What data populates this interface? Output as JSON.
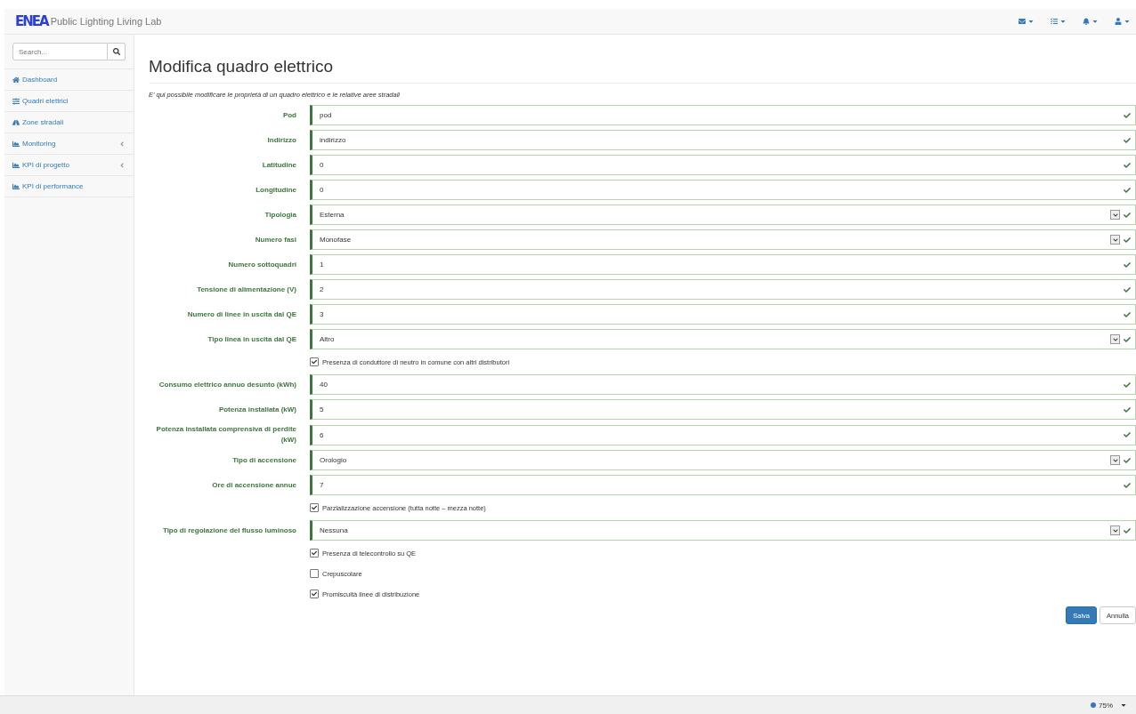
{
  "navbar": {
    "logo": "ENEA",
    "title": "Public Lighting Living Lab",
    "menus": [
      {
        "kind": "envelope"
      },
      {
        "kind": "tasks"
      },
      {
        "kind": "bell"
      },
      {
        "kind": "user"
      }
    ]
  },
  "sidebar": {
    "search": {
      "placeholder": "Search..."
    },
    "items": [
      {
        "label": "Dashboard",
        "submenu": false
      },
      {
        "label": "Quadri elettrici",
        "submenu": false
      },
      {
        "label": "Zone stradali",
        "submenu": false
      },
      {
        "label": "Monitoring",
        "submenu": true
      },
      {
        "label": "KPI di progetto",
        "submenu": true
      },
      {
        "label": "KPI di performance",
        "submenu": false
      }
    ]
  },
  "page": {
    "title": "Modifica quadro elettrico",
    "description": "E' qui possibile modificare le proprietà di un quadro elettrico e le relative aree stradali"
  },
  "form": {
    "fields": [
      {
        "kind": "text",
        "label": "Pod",
        "value": "pod",
        "valid": true
      },
      {
        "kind": "text",
        "label": "Indirizzo",
        "value": "indirizzo",
        "valid": true
      },
      {
        "kind": "text",
        "label": "Latitudine",
        "value": "0",
        "valid": true
      },
      {
        "kind": "text",
        "label": "Longitudine",
        "value": "0",
        "valid": true
      },
      {
        "kind": "select",
        "label": "Tipologia",
        "value": "Esterna",
        "valid": true
      },
      {
        "kind": "select",
        "label": "Numero fasi",
        "value": "Monofase",
        "valid": true
      },
      {
        "kind": "text",
        "label": "Numero sottoquadri",
        "value": "1",
        "valid": true
      },
      {
        "kind": "text",
        "label": "Tensione di alimentazione (V)",
        "value": "2",
        "valid": true
      },
      {
        "kind": "text",
        "label": "Numero di linee in uscita dal QE",
        "value": "3",
        "valid": true
      },
      {
        "kind": "select",
        "label": "Tipo linea in uscita dal QE",
        "value": "Altro",
        "valid": true
      },
      {
        "kind": "checkbox",
        "label": "Presenza di conduttore di neutro in comune con altri distributori",
        "checked": true
      },
      {
        "kind": "text",
        "label": "Consumo elettrico annuo desunto (kWh)",
        "value": "40",
        "valid": true
      },
      {
        "kind": "text",
        "label": "Potenza installata (kW)",
        "value": "5",
        "valid": true
      },
      {
        "kind": "text",
        "label": "Potenza installata comprensiva di perdite (kW)",
        "value": "6",
        "valid": true
      },
      {
        "kind": "select",
        "label": "Tipo di accensione",
        "value": "Orologio",
        "valid": true
      },
      {
        "kind": "text",
        "label": "Ore di accensione annue",
        "value": "7",
        "valid": true
      },
      {
        "kind": "checkbox",
        "label": "Parzializzazione accensione (tutta notte – mezza notte)",
        "checked": true
      },
      {
        "kind": "select",
        "label": "Tipo di regolazione del flusso luminoso",
        "value": "Nessuna",
        "valid": true
      },
      {
        "kind": "checkbox",
        "label": "Presenza di telecontrollo su QE",
        "checked": true
      },
      {
        "kind": "checkbox",
        "label": "Crepuscolare",
        "checked": false
      },
      {
        "kind": "checkbox",
        "label": "Promiscuità linee di distribuzione",
        "checked": true
      }
    ],
    "buttons": [
      {
        "label": "Salva",
        "primary": true
      },
      {
        "label": "Annulla",
        "primary": false
      }
    ]
  },
  "status_bar": {
    "zoom": "75%"
  }
}
